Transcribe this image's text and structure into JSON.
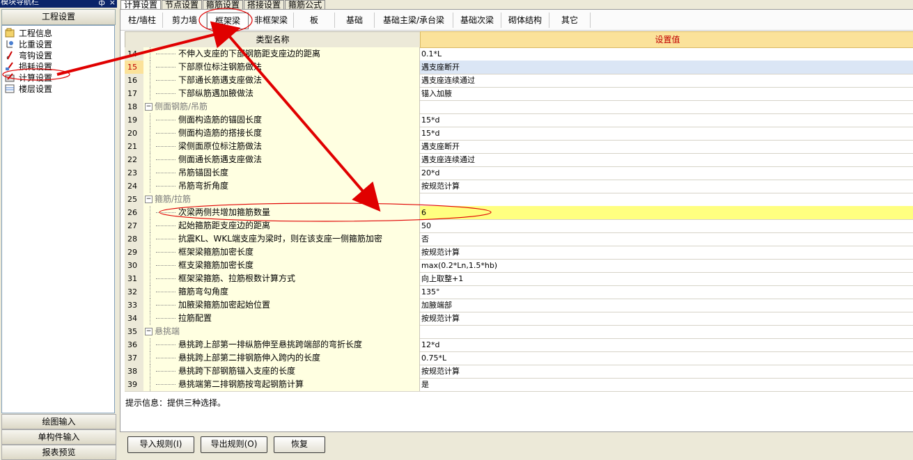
{
  "left_panel": {
    "title": "模块导航栏",
    "pin": "ф",
    "close": "×",
    "header": "工程设置",
    "tree": [
      {
        "label": "工程信息",
        "icon": "folder-info-icon"
      },
      {
        "label": "比重设置",
        "icon": "weight-settings-icon"
      },
      {
        "label": "弯钩设置",
        "icon": "hook-settings-icon"
      },
      {
        "label": "损耗设置",
        "icon": "loss-settings-icon"
      },
      {
        "label": "计算设置",
        "icon": "calc-settings-icon"
      },
      {
        "label": "楼层设置",
        "icon": "floor-settings-icon"
      }
    ],
    "bottom_buttons": [
      "绘图输入",
      "单构件输入",
      "报表预览"
    ]
  },
  "top_tabs": [
    "计算设置",
    "节点设置",
    "箍筋设置",
    "搭接设置",
    "箍筋公式"
  ],
  "sub_tabs": [
    "柱/墙柱",
    "剪力墙",
    "框架梁",
    "非框架梁",
    "板",
    "基础",
    "基础主梁/承台梁",
    "基础次梁",
    "砌体结构",
    "其它"
  ],
  "grid": {
    "col_name": "类型名称",
    "col_value": "设置值",
    "rows": [
      {
        "n": "14",
        "name": "不伸入支座的下部钢筋距支座边的距离",
        "value": "0.1*L"
      },
      {
        "n": "15",
        "name": "下部原位标注钢筋做法",
        "value": "遇支座断开"
      },
      {
        "n": "16",
        "name": "下部通长筋遇支座做法",
        "value": "遇支座连续通过"
      },
      {
        "n": "17",
        "name": "下部纵筋遇加腋做法",
        "value": "锚入加腋"
      },
      {
        "n": "18",
        "name": "侧面钢筋/吊筋",
        "value": "",
        "group": true
      },
      {
        "n": "19",
        "name": "侧面构造筋的锚固长度",
        "value": "15*d"
      },
      {
        "n": "20",
        "name": "侧面构造筋的搭接长度",
        "value": "15*d"
      },
      {
        "n": "21",
        "name": "梁侧面原位标注筋做法",
        "value": "遇支座断开"
      },
      {
        "n": "22",
        "name": "侧面通长筋遇支座做法",
        "value": "遇支座连续通过"
      },
      {
        "n": "23",
        "name": "吊筋锚固长度",
        "value": "20*d"
      },
      {
        "n": "24",
        "name": "吊筋弯折角度",
        "value": "按规范计算"
      },
      {
        "n": "25",
        "name": "箍筋/拉筋",
        "value": "",
        "group": true
      },
      {
        "n": "26",
        "name": "次梁两侧共增加箍筋数量",
        "value": "6"
      },
      {
        "n": "27",
        "name": "起始箍筋距支座边的距离",
        "value": "50"
      },
      {
        "n": "28",
        "name": "抗震KL、WKL端支座为梁时，则在该支座一侧箍筋加密",
        "value": "否"
      },
      {
        "n": "29",
        "name": "框架梁箍筋加密长度",
        "value": "按规范计算"
      },
      {
        "n": "30",
        "name": "框支梁箍筋加密长度",
        "value": "max(0.2*Ln,1.5*hb)"
      },
      {
        "n": "31",
        "name": "框架梁箍筋、拉筋根数计算方式",
        "value": "向上取整+1"
      },
      {
        "n": "32",
        "name": "箍筋弯勾角度",
        "value": "135°"
      },
      {
        "n": "33",
        "name": "加腋梁箍筋加密起始位置",
        "value": "加腋端部"
      },
      {
        "n": "34",
        "name": "拉筋配置",
        "value": "按规范计算"
      },
      {
        "n": "35",
        "name": "悬挑端",
        "value": "",
        "group": true
      },
      {
        "n": "36",
        "name": "悬挑跨上部第一排纵筋伸至悬挑跨端部的弯折长度",
        "value": "12*d"
      },
      {
        "n": "37",
        "name": "悬挑跨上部第二排钢筋伸入跨内的长度",
        "value": "0.75*L"
      },
      {
        "n": "38",
        "name": "悬挑跨下部钢筋锚入支座的长度",
        "value": "按规范计算"
      },
      {
        "n": "39",
        "name": "悬挑端第二排钢筋按弯起钢筋计算",
        "value": "是"
      }
    ]
  },
  "hint": "提示信息：提供三种选择。",
  "bottom_buttons": [
    "导入规则(I)",
    "导出规则(O)",
    "恢复"
  ],
  "colors": {
    "annotation": "#e00000",
    "value_header": "#fbe29a",
    "selected_row": "#ffff80"
  }
}
